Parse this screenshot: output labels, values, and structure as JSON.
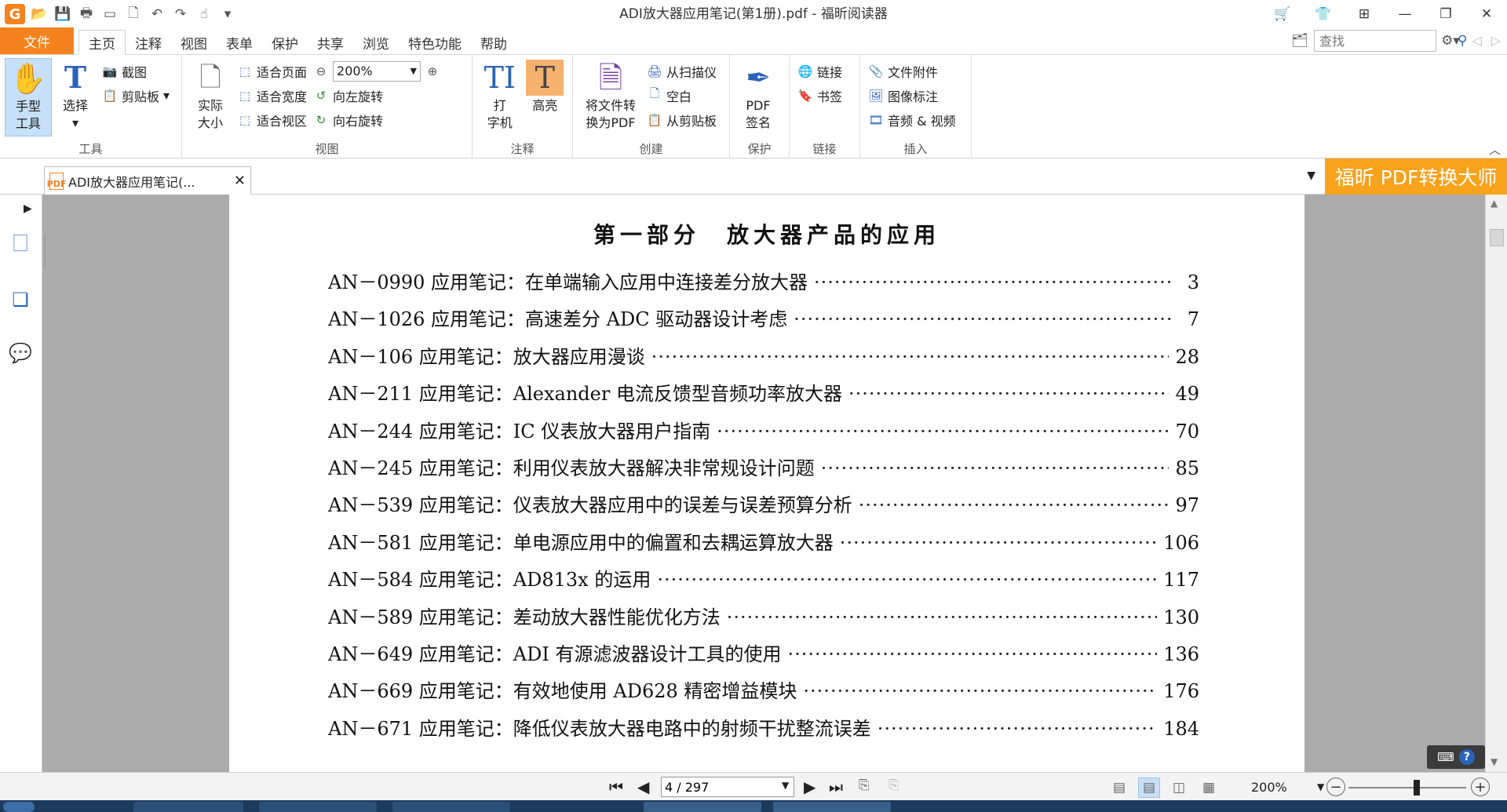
{
  "window": {
    "title": "ADI放大器应用笔记(第1册).pdf - 福昕阅读器"
  },
  "menu": {
    "file_label": "文件",
    "tabs": [
      {
        "label": "主页",
        "active": true
      },
      {
        "label": "注释"
      },
      {
        "label": "视图"
      },
      {
        "label": "表单"
      },
      {
        "label": "保护"
      },
      {
        "label": "共享"
      },
      {
        "label": "浏览"
      },
      {
        "label": "特色功能"
      },
      {
        "label": "帮助"
      }
    ],
    "search_placeholder": "查找"
  },
  "ribbon": {
    "tools": {
      "label": "工具",
      "hand_line1": "手型",
      "hand_line2": "工具",
      "select": "选择",
      "screenshot": "截图",
      "clipboard": "剪贴板"
    },
    "view": {
      "label": "视图",
      "actual_size_line1": "实际",
      "actual_size_line2": "大小",
      "fit_page": "适合页面",
      "fit_width": "适合宽度",
      "fit_visible": "适合视区",
      "zoom_value": "200%",
      "rotate_left": "向左旋转",
      "rotate_right": "向右旋转"
    },
    "comment": {
      "label": "注释",
      "typewriter_line1": "打",
      "typewriter_line2": "字机",
      "highlight": "高亮"
    },
    "create": {
      "label": "创建",
      "convert_line1": "将文件转",
      "convert_line2": "换为PDF",
      "from_scanner": "从扫描仪",
      "blank": "空白",
      "from_clipboard": "从剪贴板"
    },
    "protect": {
      "label": "保护",
      "sign_line1": "PDF",
      "sign_line2": "签名"
    },
    "links": {
      "label": "链接",
      "link": "链接",
      "bookmark": "书签"
    },
    "insert": {
      "label": "插入",
      "attachment": "文件附件",
      "image_annotation": "图像标注",
      "audio_video": "音频 & 视频"
    }
  },
  "document_tab": {
    "title": "ADI放大器应用笔记(..."
  },
  "promo": {
    "text": "福昕 PDF转换大师"
  },
  "page": {
    "heading": "第一部分　放大器产品的应用",
    "toc": [
      {
        "title": "AN－0990 应用笔记：在单端输入应用中连接差分放大器",
        "page": "3"
      },
      {
        "title": "AN－1026 应用笔记：高速差分 ADC 驱动器设计考虑",
        "page": "7"
      },
      {
        "title": "AN－106 应用笔记：放大器应用漫谈",
        "page": "28"
      },
      {
        "title": "AN－211 应用笔记：Alexander 电流反馈型音频功率放大器",
        "page": "49"
      },
      {
        "title": "AN－244 应用笔记：IC 仪表放大器用户指南",
        "page": "70"
      },
      {
        "title": "AN－245 应用笔记：利用仪表放大器解决非常规设计问题",
        "page": "85"
      },
      {
        "title": "AN－539 应用笔记：仪表放大器应用中的误差与误差预算分析",
        "page": "97"
      },
      {
        "title": "AN－581 应用笔记：单电源应用中的偏置和去耦运算放大器",
        "page": "106"
      },
      {
        "title": "AN－584 应用笔记：AD813x 的运用",
        "page": "117"
      },
      {
        "title": "AN－589 应用笔记：差动放大器性能优化方法",
        "page": "130"
      },
      {
        "title": "AN－649 应用笔记：ADI 有源滤波器设计工具的使用",
        "page": "136"
      },
      {
        "title": "AN－669 应用笔记：有效地使用 AD628 精密增益模块",
        "page": "176"
      },
      {
        "title": "AN－671 应用笔记：降低仪表放大器电路中的射频干扰整流误差",
        "page": "184"
      }
    ]
  },
  "statusbar": {
    "page_indicator": "4 / 297",
    "zoom": "200%",
    "zoom_slider_fraction": 0.58
  },
  "colors": {
    "brand_orange": "#f5821f",
    "promo_orange": "#f9a21b",
    "accent_blue": "#2a64b7",
    "doc_background": "#ababab"
  }
}
